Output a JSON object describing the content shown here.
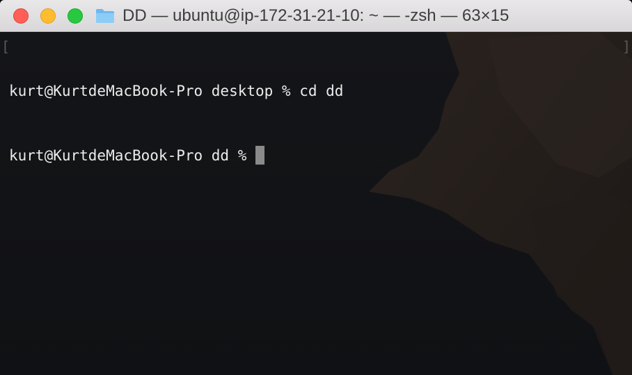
{
  "window": {
    "title": "DD — ubuntu@ip-172-31-21-10: ~ — -zsh — 63×15",
    "buttons": {
      "close": "close-window",
      "minimize": "minimize-window",
      "zoom": "zoom-window"
    },
    "folder_icon": "folder-icon"
  },
  "terminal": {
    "lines": [
      "kurt@KurtdeMacBook-Pro desktop % cd dd",
      "kurt@KurtdeMacBook-Pro dd % "
    ],
    "left_marker": "[",
    "right_marker": "]"
  },
  "colors": {
    "titlebar": "#e2e1e2",
    "terminal_bg": "#121315",
    "text": "#ececec",
    "cursor": "#8a8a8a",
    "close": "#ff5f57",
    "minimize": "#febc2e",
    "zoom": "#28c840",
    "folder": "#7fc1f2"
  }
}
